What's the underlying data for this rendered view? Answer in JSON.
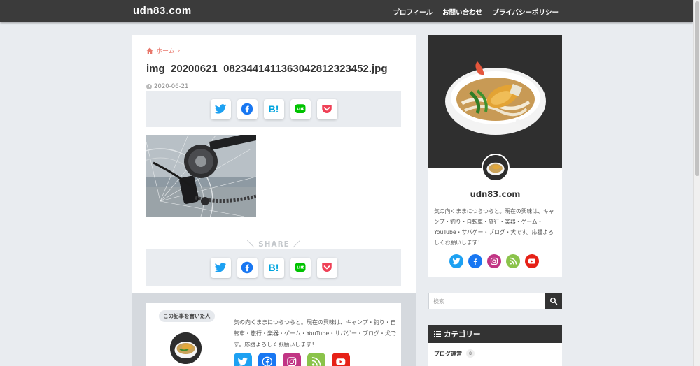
{
  "header": {
    "site_title": "udn83.com",
    "nav": [
      "プロフィール",
      "お問い合わせ",
      "プライバシーポリシー"
    ]
  },
  "article": {
    "breadcrumb_home": "ホーム",
    "breadcrumb_sep": "›",
    "title": "img_20200621_082344141136304281232345​2.jpg",
    "date": "2020-06-21",
    "share_label": "SHARE",
    "hatena_label": "B!"
  },
  "author": {
    "badge": "この記事を書いた人",
    "bio": "気の向くままにつらつらと。現在の興味は、キャンプ・釣り・自転車・旅行・楽器・ゲーム・YouTube・サバゲー・ブログ・犬です。応援よろしくお願いします！"
  },
  "sidebar": {
    "profile_name": "udn83.com",
    "profile_bio": "気の向くままにつらつらと。現在の興味は、キャンプ・釣り・自転車・旅行・楽器・ゲーム・YouTube・サバゲー・ブログ・犬です。応援よろしくお願いします！",
    "search_placeholder": "検索",
    "categories_title": "カテゴリー",
    "categories": [
      {
        "name": "ブログ運営",
        "count": "8"
      }
    ]
  },
  "colors": {
    "twitter": "#1da1f2",
    "facebook": "#1877f2",
    "hatena": "#00a4de",
    "line": "#00c300",
    "pocket": "#ef4056",
    "instagram": "#c13584",
    "rss": "#8bc34a",
    "youtube": "#e62117",
    "accent": "#e8776b"
  }
}
